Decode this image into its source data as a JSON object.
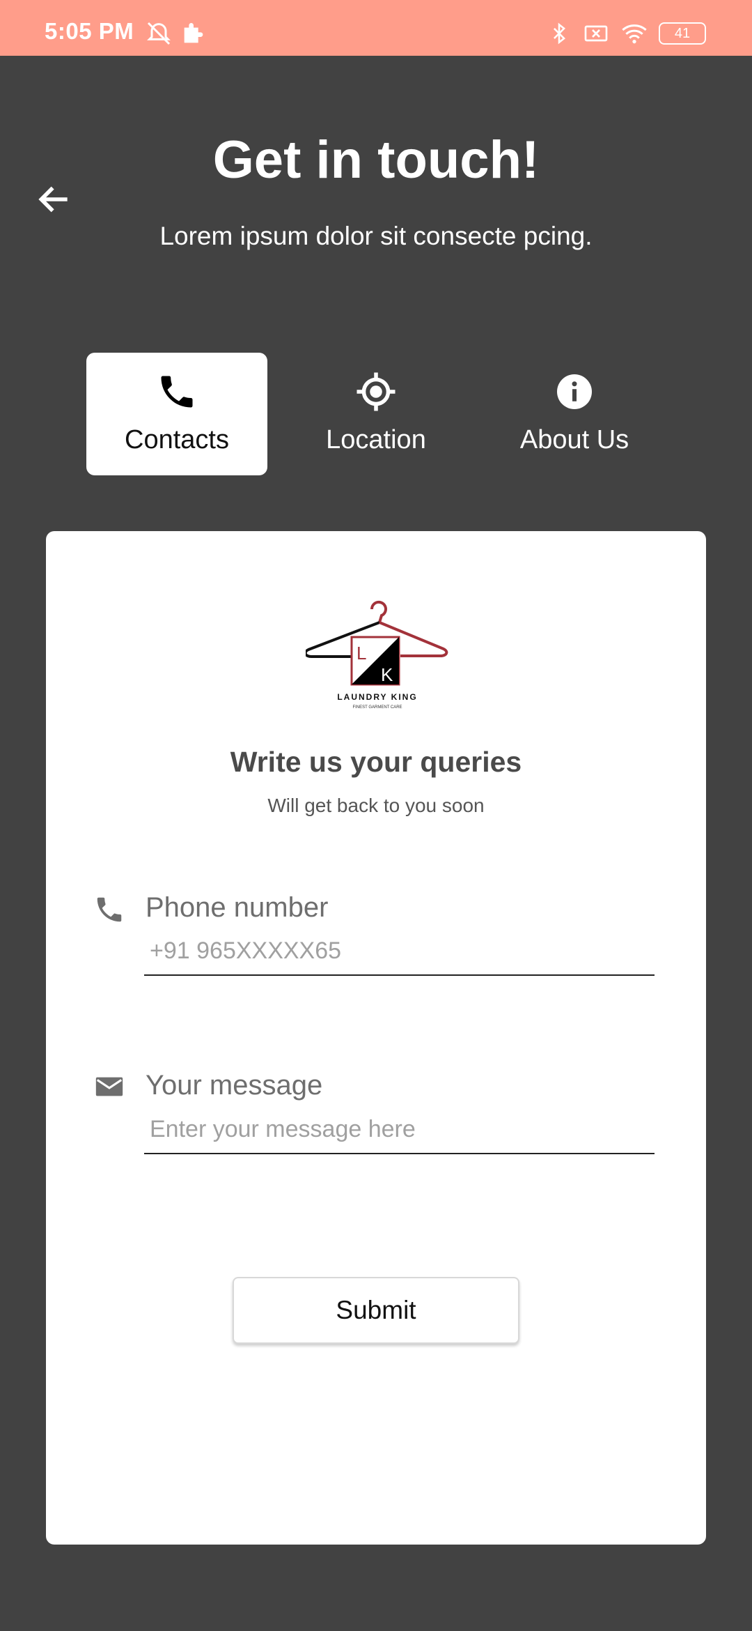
{
  "status_bar": {
    "time": "5:05 PM",
    "battery": "41",
    "icons": [
      "mute-alarm-icon",
      "puzzle-icon",
      "bluetooth-icon",
      "sim-off-icon",
      "wifi-icon",
      "battery-icon"
    ]
  },
  "header": {
    "title": "Get in touch!",
    "subtitle": "Lorem ipsum dolor sit consecte pcing.",
    "back_icon": "arrow-left-icon"
  },
  "tabs": [
    {
      "label": "Contacts",
      "icon": "phone-icon",
      "active": true
    },
    {
      "label": "Location",
      "icon": "crosshair-icon",
      "active": false
    },
    {
      "label": "About Us",
      "icon": "info-icon",
      "active": false
    }
  ],
  "card": {
    "logo": {
      "initials_1": "L",
      "initials_2": "K",
      "name": "LAUNDRY KING",
      "tagline": "FINEST GARMENT CARE"
    },
    "title": "Write us your queries",
    "subtitle": "Will get back to you soon",
    "phone": {
      "label": "Phone number",
      "placeholder": "+91 965XXXXX65",
      "value": "",
      "icon": "phone-icon"
    },
    "message": {
      "label": "Your message",
      "placeholder": "Enter your message here",
      "value": "",
      "icon": "mail-icon"
    },
    "submit_label": "Submit"
  },
  "colors": {
    "status_bar": "#ff9d8a",
    "background": "#424242",
    "card": "#ffffff",
    "logo_red": "#a3323a"
  }
}
